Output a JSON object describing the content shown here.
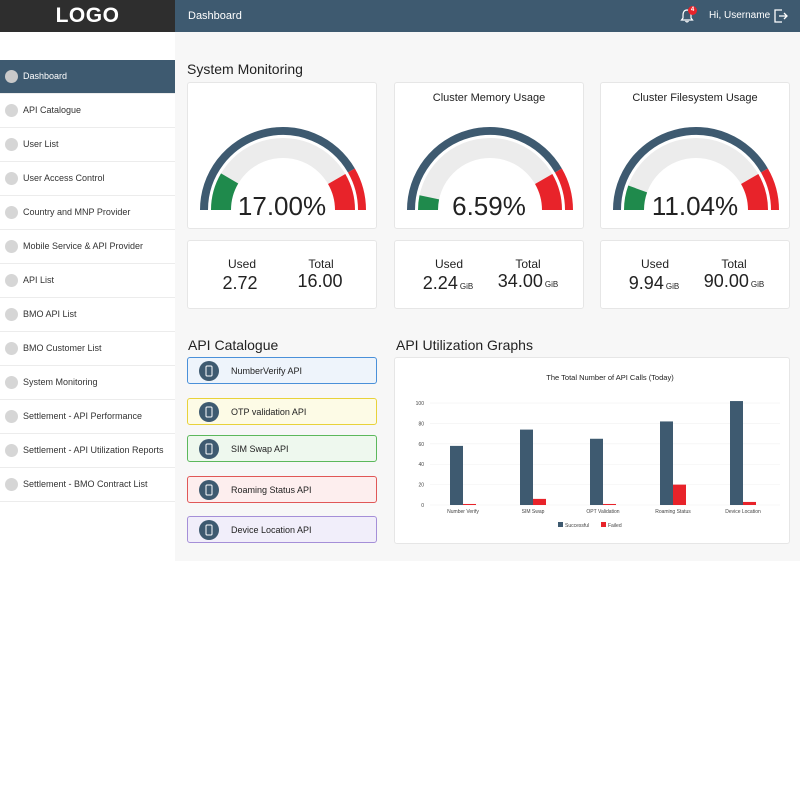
{
  "header": {
    "logo": "LOGO",
    "title": "Dashboard",
    "notification_count": "4",
    "greeting": "Hi, Username"
  },
  "sidebar": {
    "items": [
      {
        "label": "Dashboard",
        "active": true
      },
      {
        "label": "API Catalogue"
      },
      {
        "label": "User List"
      },
      {
        "label": "User Access Control"
      },
      {
        "label": "Country and MNP Provider"
      },
      {
        "label": "Mobile Service & API Provider"
      },
      {
        "label": "API List"
      },
      {
        "label": "BMO API List"
      },
      {
        "label": "BMO Customer List"
      },
      {
        "label": "System Monitoring"
      },
      {
        "label": "Settlement - API Performance"
      },
      {
        "label": "Settlement - API Utilization Reports"
      },
      {
        "label": "Settlement - BMO Contract List"
      }
    ]
  },
  "system_monitoring": {
    "title": "System Monitoring",
    "gauges": [
      {
        "title": "",
        "value": "17.00%",
        "fraction": 0.17,
        "used_label": "Used",
        "used": "2.72",
        "used_unit": "",
        "total_label": "Total",
        "total": "16.00",
        "total_unit": ""
      },
      {
        "title": "Cluster Memory Usage",
        "value": "6.59%",
        "fraction": 0.0659,
        "used_label": "Used",
        "used": "2.24",
        "used_unit": "GiB",
        "total_label": "Total",
        "total": "34.00",
        "total_unit": "GiB"
      },
      {
        "title": "Cluster Filesystem Usage",
        "value": "11.04%",
        "fraction": 0.1104,
        "used_label": "Used",
        "used": "9.94",
        "used_unit": "GiB",
        "total_label": "Total",
        "total": "90.00",
        "total_unit": "GiB"
      }
    ],
    "colors": {
      "track": "#3e5a70",
      "used": "#1f8a4c",
      "danger": "#e8232a",
      "inner": "#ececec"
    }
  },
  "api_catalogue": {
    "title": "API Catalogue",
    "items": [
      {
        "label": "NumberVerify API",
        "icon": "phone-check-icon",
        "bg": "#eef4fb",
        "border": "#4a90d9"
      },
      {
        "label": "OTP validation API",
        "icon": "otp-phone-icon",
        "bg": "#fdfbe6",
        "border": "#e8d23a"
      },
      {
        "label": "SIM Swap API",
        "icon": "sim-swap-icon",
        "bg": "#eef8ee",
        "border": "#5cb85c"
      },
      {
        "label": "Roaming Status API",
        "icon": "api-cloud-icon",
        "bg": "#fdeeee",
        "border": "#e05757"
      },
      {
        "label": "Device Location API",
        "icon": "api-cloud-location-icon",
        "bg": "#f1eefa",
        "border": "#a58fd8"
      }
    ]
  },
  "api_utilization": {
    "title": "API Utilization Graphs"
  },
  "chart_data": {
    "type": "bar",
    "title": "The Total Number of API Calls (Today)",
    "categories": [
      "Number Verify",
      "SIM Swap",
      "OPT Validation",
      "Roaming Status",
      "Device Location"
    ],
    "series": [
      {
        "name": "Successful",
        "values": [
          58,
          74,
          65,
          82,
          102
        ],
        "color": "#3e5a70"
      },
      {
        "name": "Failed",
        "values": [
          1,
          6,
          1,
          20,
          3
        ],
        "color": "#e8232a"
      }
    ],
    "yticks": [
      0,
      20,
      40,
      60,
      80,
      100
    ],
    "ylim": [
      0,
      105
    ],
    "legend_position": "bottom"
  }
}
